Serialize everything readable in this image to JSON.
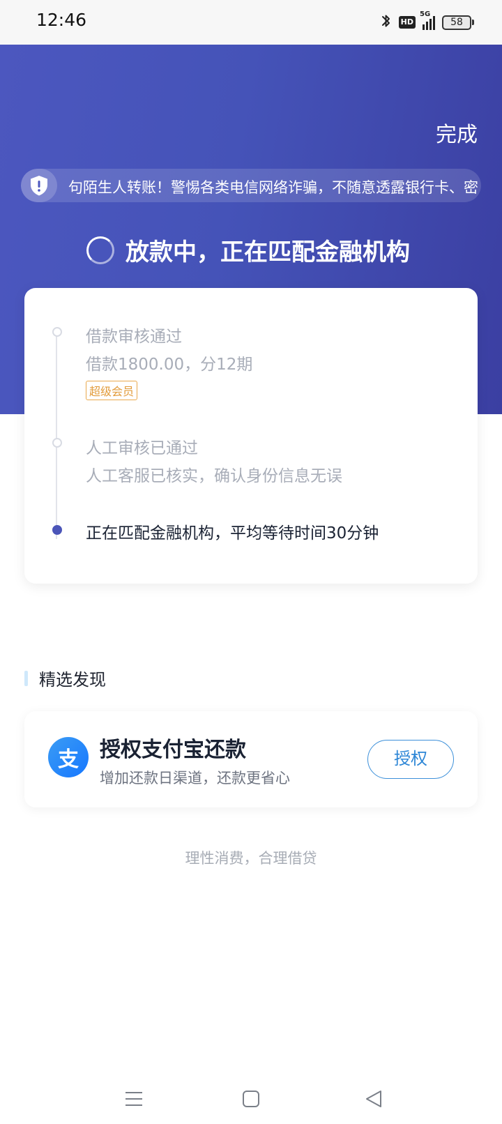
{
  "status_bar": {
    "time": "12:46",
    "network": "5G",
    "hd": "HD",
    "battery": "58"
  },
  "header": {
    "done_label": "完成",
    "notice_text": "句陌生人转账！警惕各类电信网络诈骗，不随意透露银行卡、密",
    "status_title": "放款中，正在匹配金融机构"
  },
  "progress": {
    "steps": [
      {
        "title": "借款审核通过",
        "desc": "借款1800.00，分12期",
        "badge": "超级会员"
      },
      {
        "title": "人工审核已通过",
        "desc": "人工客服已核实，确认身份信息无误"
      },
      {
        "title": "正在匹配金融机构，平均等待时间30分钟"
      }
    ]
  },
  "discover": {
    "section_title": "精选发现",
    "card": {
      "logo": "支",
      "title": "授权支付宝还款",
      "subtitle": "增加还款日渠道，还款更省心",
      "button": "授权"
    }
  },
  "footer": {
    "note": "理性消费，合理借贷"
  },
  "colors": {
    "hero_start": "#4c57bf",
    "hero_end": "#3b3fa2",
    "active_dot": "#4b55b8",
    "auth_blue": "#2d86d6",
    "vip_orange": "#e29b3a"
  },
  "icons": {
    "bluetooth": "bluetooth-icon",
    "shield": "shield-icon",
    "spinner": "loading-spinner-icon",
    "alipay": "alipay-logo-icon",
    "nav_menu": "menu-icon",
    "nav_home": "home-square-icon",
    "nav_back": "back-triangle-icon"
  }
}
